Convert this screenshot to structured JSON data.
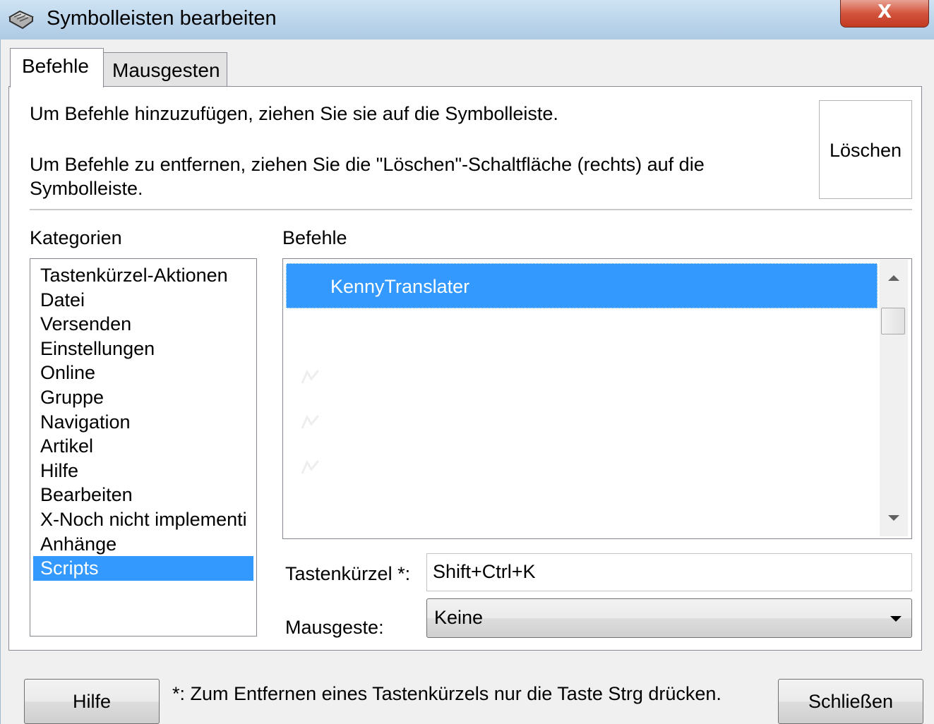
{
  "window": {
    "title": "Symbolleisten bearbeiten",
    "close_label": "X"
  },
  "tabs": [
    {
      "label": "Befehle",
      "active": true
    },
    {
      "label": "Mausgesten",
      "active": false
    }
  ],
  "instructions": {
    "add_hint": "Um Befehle hinzuzufügen, ziehen Sie sie auf die Symbolleiste.",
    "remove_hint": "Um Befehle zu entfernen, ziehen Sie die \"Löschen\"-Schaltfläche (rechts) auf die Symbolleiste.",
    "delete_button": "Löschen"
  },
  "categories": {
    "label": "Kategorien",
    "items": [
      "Tastenkürzel-Aktionen",
      "Datei",
      "Versenden",
      "Einstellungen",
      "Online",
      "Gruppe",
      "Navigation",
      "Artikel",
      "Hilfe",
      "Bearbeiten",
      "X-Noch nicht implementi",
      "Anhänge",
      "Scripts"
    ],
    "selected": "Scripts"
  },
  "commands": {
    "label": "Befehle",
    "items": [
      {
        "label": "KennyTranslater",
        "selected": true
      },
      {
        "label": "",
        "selected": false
      },
      {
        "label": "",
        "selected": false
      },
      {
        "label": "",
        "selected": false
      },
      {
        "label": "",
        "selected": false
      },
      {
        "label": "",
        "selected": false
      }
    ]
  },
  "shortcut": {
    "label": "Tastenkürzel *:",
    "value": "Shift+Ctrl+K"
  },
  "gesture": {
    "label": "Mausgeste:",
    "value": "Keine"
  },
  "footer": {
    "help_button": "Hilfe",
    "note": "*: Zum Entfernen eines Tastenkürzels nur die Taste Strg drücken.",
    "close_button": "Schließen"
  },
  "colors": {
    "selection": "#3399ff",
    "close_button": "#c94a33"
  }
}
